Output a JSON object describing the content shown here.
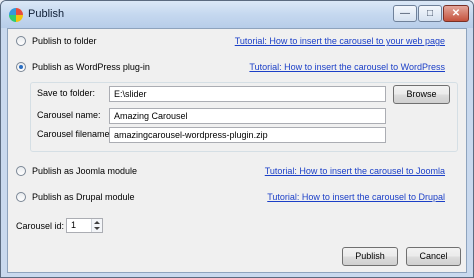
{
  "window": {
    "title": "Publish",
    "min_symbol": "—",
    "max_symbol": "□",
    "close_symbol": "✕"
  },
  "options": {
    "folder": {
      "label": "Publish to folder",
      "link": "Tutorial: How to insert the carousel to your web page"
    },
    "wordpress": {
      "label": "Publish as WordPress plug-in",
      "link": "Tutorial: How to insert the carousel to WordPress",
      "save_label": "Save to folder:",
      "save_value": "E:\\slider",
      "browse_label": "Browse",
      "name_label": "Carousel name:",
      "name_value": "Amazing Carousel",
      "filename_label": "Carousel filename:",
      "filename_value": "amazingcarousel-wordpress-plugin.zip"
    },
    "joomla": {
      "label": "Publish as Joomla module",
      "link": "Tutorial: How to insert the carousel to Joomla"
    },
    "drupal": {
      "label": "Publish as Drupal module",
      "link": "Tutorial: How to insert the carousel to Drupal"
    }
  },
  "selected_option": "wordpress",
  "carousel_id": {
    "label": "Carousel id:",
    "value": "1"
  },
  "buttons": {
    "publish": "Publish",
    "cancel": "Cancel"
  },
  "colors": {
    "link": "#1b3fc7",
    "radio_selected": "#2a6ec2"
  }
}
